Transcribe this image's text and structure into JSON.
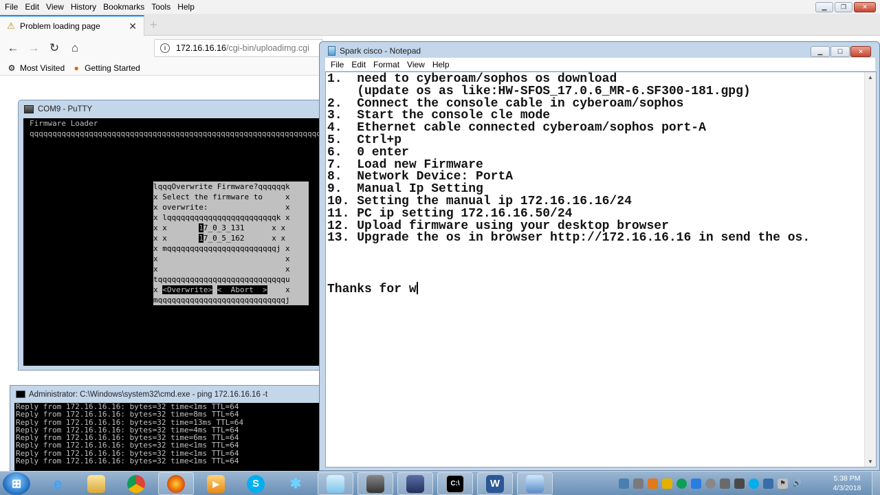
{
  "firefox": {
    "menu": [
      "File",
      "Edit",
      "View",
      "History",
      "Bookmarks",
      "Tools",
      "Help"
    ],
    "tab_title": "Problem loading page",
    "url_host": "172.16.16.16",
    "url_path": "/cgi-bin/uploadimg.cgi",
    "bookmarks": [
      "Most Visited",
      "Getting Started"
    ]
  },
  "putty": {
    "title": "COM9 - PuTTY",
    "header": "Firmware Loader",
    "rule": "qqqqqqqqqqqqqqqqqqqqqqqqqqqqqqqqqqqqqqqqqqqqqqqqqqqqqqqqqqqqqqqqqqqqqqqqqq",
    "dialog": {
      "top": "lqqqOverwrite Firmware?qqqqqqk",
      "line1": "x Select the firmware to     x",
      "line2": "x overwrite:                 x",
      "box_top": "x lqqqqqqqqqqqqqqqqqqqqqqqqk x",
      "fw1_pre": "x x       ",
      "fw1_sel": "1",
      "fw1_post": "7_0_3_131      x x",
      "fw2_pre": "x x       ",
      "fw2_sel": "1",
      "fw2_post": "7_0_5_162      x x",
      "box_bottom": "x mqqqqqqqqqqqqqqqqqqqqqqqqj x",
      "blank1": "x                            x",
      "blank2": "x                            x",
      "sep": "tqqqqqqqqqqqqqqqqqqqqqqqqqqqqu",
      "btn_prefix": "x ",
      "btn_overwrite": "<Overwrite>",
      "btn_gap": " ",
      "btn_abort": "<  Abort  >",
      "btn_suffix": "    x",
      "bottom": "mqqqqqqqqqqqqqqqqqqqqqqqqqqqqj"
    }
  },
  "cmd": {
    "title": "Administrator: C:\\Windows\\system32\\cmd.exe - ping  172.16.16.16 -t",
    "lines": [
      "Reply from 172.16.16.16: bytes=32 time<1ms TTL=64",
      "Reply from 172.16.16.16: bytes=32 time=8ms TTL=64",
      "Reply from 172.16.16.16: bytes=32 time=13ms TTL=64",
      "Reply from 172.16.16.16: bytes=32 time=4ms TTL=64",
      "Reply from 172.16.16.16: bytes=32 time=6ms TTL=64",
      "Reply from 172.16.16.16: bytes=32 time<1ms TTL=64",
      "Reply from 172.16.16.16: bytes=32 time<1ms TTL=64",
      "Reply from 172.16.16.16: bytes=32 time<1ms TTL=64"
    ]
  },
  "notepad": {
    "title": "Spark cisco - Notepad",
    "menu": [
      "File",
      "Edit",
      "Format",
      "View",
      "Help"
    ],
    "lines": [
      "1.  need to cyberoam/sophos os download",
      "    (update os as like:HW-SFOS_17.0.6_MR-6.SF300-181.gpg)",
      "2.  Connect the console cable in cyberoam/sophos",
      "3.  Start the console cle mode",
      "4.  Ethernet cable connected cyberoam/sophos port-A",
      "5.  Ctrl+p",
      "6.  0 enter",
      "7.  Load new Firmware",
      "8.  Network Device: PortA",
      "9.  Manual Ip Setting",
      "10. Setting the manual ip 172.16.16.16/24",
      "11. PC ip setting 172.16.16.50/24",
      "12. Upload firmware using your desktop browser",
      "13. Upgrade the os in browser http://172.16.16.16 in send the os.",
      "",
      "",
      "",
      "Thanks for w"
    ]
  },
  "taskbar": {
    "time": "5:38 PM",
    "date": "4/3/2018"
  }
}
